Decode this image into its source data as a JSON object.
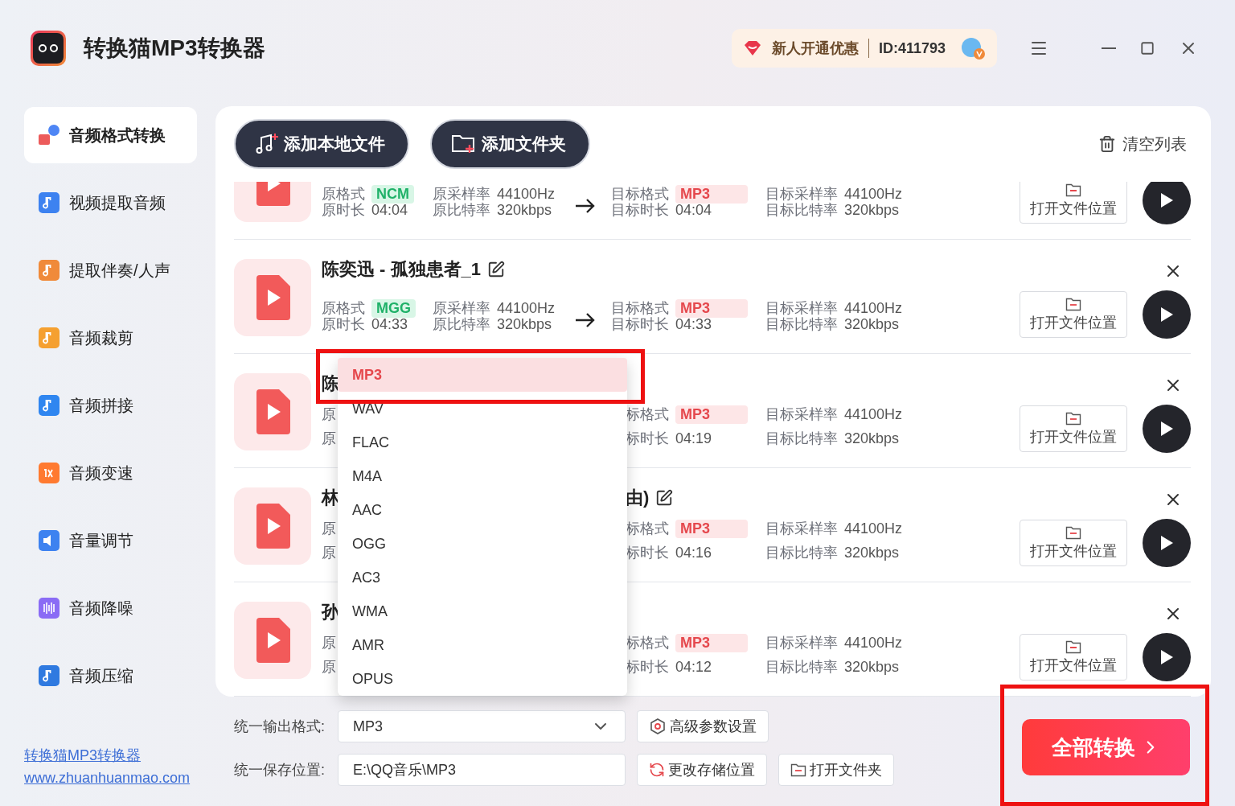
{
  "app": {
    "title": "转换猫MP3转换器"
  },
  "promo": {
    "label": "新人开通优惠",
    "user_id": "ID:411793"
  },
  "sidebar": {
    "items": [
      {
        "label": "音频格式转换",
        "selected": true
      },
      {
        "label": "视频提取音频",
        "selected": false
      },
      {
        "label": "提取伴奏/人声",
        "selected": false
      },
      {
        "label": "音频裁剪",
        "selected": false
      },
      {
        "label": "音频拼接",
        "selected": false
      },
      {
        "label": "音频变速",
        "selected": false
      },
      {
        "label": "音量调节",
        "selected": false
      },
      {
        "label": "音频降噪",
        "selected": false
      },
      {
        "label": "音频压缩",
        "selected": false
      }
    ],
    "footer_links": [
      "转换猫MP3转换器",
      "www.zhuanhuanmao.com"
    ]
  },
  "toolbar": {
    "buttons": [
      "添加本地文件",
      "添加文件夹"
    ],
    "clear": "清空列表"
  },
  "files": [
    {
      "kind": "scrolled",
      "src_format_label": "原格式",
      "src_format": "NCM",
      "src_duration_label": "原时长",
      "src_duration": "04:04",
      "src_rate_label": "原采样率",
      "src_rate": "44100Hz",
      "src_bitrate_label": "原比特率",
      "src_bitrate": "320kbps",
      "dst_format_label": "目标格式",
      "dst_format": "MP3",
      "dst_duration_label": "目标时长",
      "dst_duration": "04:04",
      "dst_rate_label": "目标采样率",
      "dst_rate": "44100Hz",
      "dst_bitrate_label": "目标比特率",
      "dst_bitrate": "320kbps",
      "open_button": "打开文件位置"
    },
    {
      "kind": "full",
      "title": "陈奕迅 - 孤独患者_1",
      "src_format_label": "原格式",
      "src_format": "MGG",
      "src_duration_label": "原时长",
      "src_duration": "04:33",
      "src_rate_label": "原采样率",
      "src_rate": "44100Hz",
      "src_bitrate_label": "原比特率",
      "src_bitrate": "320kbps",
      "dst_format_label": "目标格式",
      "dst_format": "MP3",
      "dst_duration_label": "目标时长",
      "dst_duration": "04:33",
      "dst_rate_label": "目标采样率",
      "dst_rate": "44100Hz",
      "dst_bitrate_label": "目标比特率",
      "dst_bitrate": "320kbps",
      "open_button": "打开文件位置"
    },
    {
      "kind": "covered",
      "title_head": "陈",
      "src_format_label": "原",
      "src_duration_label": "原",
      "dst_format_label": "标格式",
      "dst_format": "MP3",
      "dst_duration_label": "标时长",
      "dst_duration": "04:19",
      "dst_rate_label": "目标采样率",
      "dst_rate": "44100Hz",
      "dst_bitrate_label": "目标比特率",
      "dst_bitrate": "320kbps",
      "open_button": "打开文件位置"
    },
    {
      "kind": "covered",
      "title_head": "林",
      "title_tail": "由)",
      "src_format_label": "原",
      "src_duration_label": "原",
      "dst_format_label": "标格式",
      "dst_format": "MP3",
      "dst_duration_label": "标时长",
      "dst_duration": "04:16",
      "dst_rate_label": "目标采样率",
      "dst_rate": "44100Hz",
      "dst_bitrate_label": "目标比特率",
      "dst_bitrate": "320kbps",
      "open_button": "打开文件位置"
    },
    {
      "kind": "covered",
      "title_head": "孙",
      "src_format_label": "原",
      "src_duration_label": "原",
      "dst_format_label": "标格式",
      "dst_format": "MP3",
      "dst_duration_label": "标时长",
      "dst_duration": "04:12",
      "dst_rate_label": "目标采样率",
      "dst_rate": "44100Hz",
      "dst_bitrate_label": "目标比特率",
      "dst_bitrate": "320kbps",
      "open_button": "打开文件位置"
    }
  ],
  "format_menu": {
    "options": [
      {
        "label": "MP3",
        "selected": true
      },
      {
        "label": "WAV",
        "selected": false
      },
      {
        "label": "FLAC",
        "selected": false
      },
      {
        "label": "M4A",
        "selected": false
      },
      {
        "label": "AAC",
        "selected": false
      },
      {
        "label": "OGG",
        "selected": false
      },
      {
        "label": "AC3",
        "selected": false
      },
      {
        "label": "WMA",
        "selected": false
      },
      {
        "label": "AMR",
        "selected": false
      },
      {
        "label": "OPUS",
        "selected": false
      }
    ]
  },
  "output": {
    "format_label": "统一输出格式:",
    "format_value": "MP3",
    "advanced_button": "高级参数设置",
    "location_label": "统一保存位置:",
    "location_value": "E:\\QQ音乐\\MP3",
    "change_button": "更改存储位置",
    "open_folder_button": "打开文件夹",
    "convert_button": "全部转换"
  }
}
